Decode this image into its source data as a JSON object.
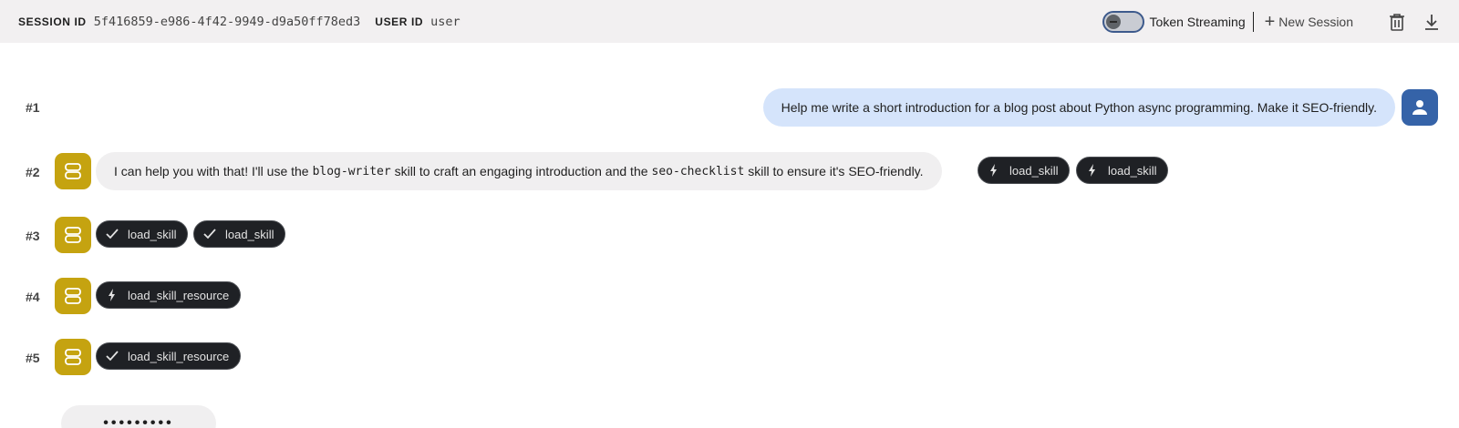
{
  "header": {
    "session_label": "SESSION ID",
    "session_id": "5f416859-e986-4f42-9949-d9a50ff78ed3",
    "user_label": "USER ID",
    "user_id": "user",
    "token_streaming_label": "Token Streaming",
    "token_streaming_on": false,
    "new_session_label": "New Session",
    "icons": [
      "minus-icon",
      "plus-icon",
      "trash-icon",
      "download-icon"
    ]
  },
  "messages": [
    {
      "index": "#1",
      "role": "user",
      "text": "Help me write a short introduction for a blog post about Python async programming. Make it SEO-friendly."
    },
    {
      "index": "#2",
      "role": "bot",
      "text_part1": "I can help you with that! I'll use the",
      "code1": "blog-writer",
      "text_part2": "skill to craft an engaging introduction and the",
      "code2": "seo-checklist",
      "text_part3": "skill to ensure it's SEO-friendly.",
      "pills": [
        {
          "icon": "bolt-icon",
          "label": "load_skill"
        },
        {
          "icon": "bolt-icon",
          "label": "load_skill"
        }
      ]
    },
    {
      "index": "#3",
      "role": "bot",
      "pills": [
        {
          "icon": "check-icon",
          "label": "load_skill"
        },
        {
          "icon": "check-icon",
          "label": "load_skill"
        }
      ]
    },
    {
      "index": "#4",
      "role": "bot",
      "pills": [
        {
          "icon": "bolt-icon",
          "label": "load_skill_resource"
        }
      ]
    },
    {
      "index": "#5",
      "role": "bot",
      "pills": [
        {
          "icon": "check-icon",
          "label": "load_skill_resource"
        }
      ]
    }
  ],
  "typing_indicator": "•••••••••",
  "colors": {
    "bot_avatar": "#c5a310",
    "user_avatar": "#3563a8",
    "user_bubble": "#d5e4fb",
    "pill_bg": "#1f2125"
  }
}
